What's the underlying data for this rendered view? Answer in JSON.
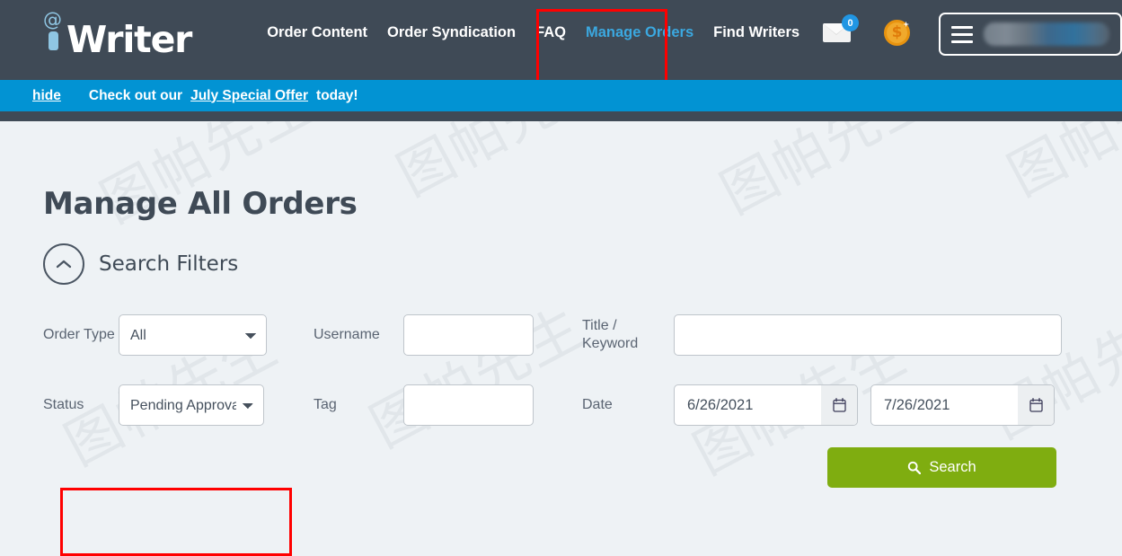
{
  "brand": {
    "logo_at": "@",
    "logo_text": "Writer",
    "accent_blue": "#3ba8e0",
    "header_bg": "#3f4a56",
    "announce_bg": "#0293d3",
    "search_green": "#7fad10",
    "annotation_red": "#ff0000"
  },
  "nav": {
    "links": [
      {
        "label": "Order Content",
        "active": false
      },
      {
        "label": "Order Syndication",
        "active": false
      },
      {
        "label": "FAQ",
        "active": false
      },
      {
        "label": "Manage Orders",
        "active": true
      },
      {
        "label": "Find Writers",
        "active": false
      }
    ],
    "mail_badge": "0",
    "coin_symbol": "$",
    "account_name": ""
  },
  "announcement": {
    "hide_label": "hide",
    "text_before": "Check out our",
    "link_label": "July Special Offer",
    "text_after": "today!"
  },
  "page": {
    "title": "Manage All Orders",
    "filters_title": "Search Filters"
  },
  "filters": {
    "order_type": {
      "label": "Order Type",
      "value": "All",
      "options": [
        "All"
      ]
    },
    "username": {
      "label": "Username",
      "value": "",
      "placeholder": ""
    },
    "title_keyword": {
      "label": "Title / Keyword",
      "value": "",
      "placeholder": ""
    },
    "status": {
      "label": "Status",
      "value": "Pending Approval",
      "options": [
        "Pending Approval"
      ]
    },
    "tag": {
      "label": "Tag",
      "value": "",
      "placeholder": ""
    },
    "date": {
      "label": "Date",
      "from": "6/26/2021",
      "to": "7/26/2021"
    },
    "search_button": "Search"
  },
  "watermark": {
    "text": "图帕先生"
  }
}
